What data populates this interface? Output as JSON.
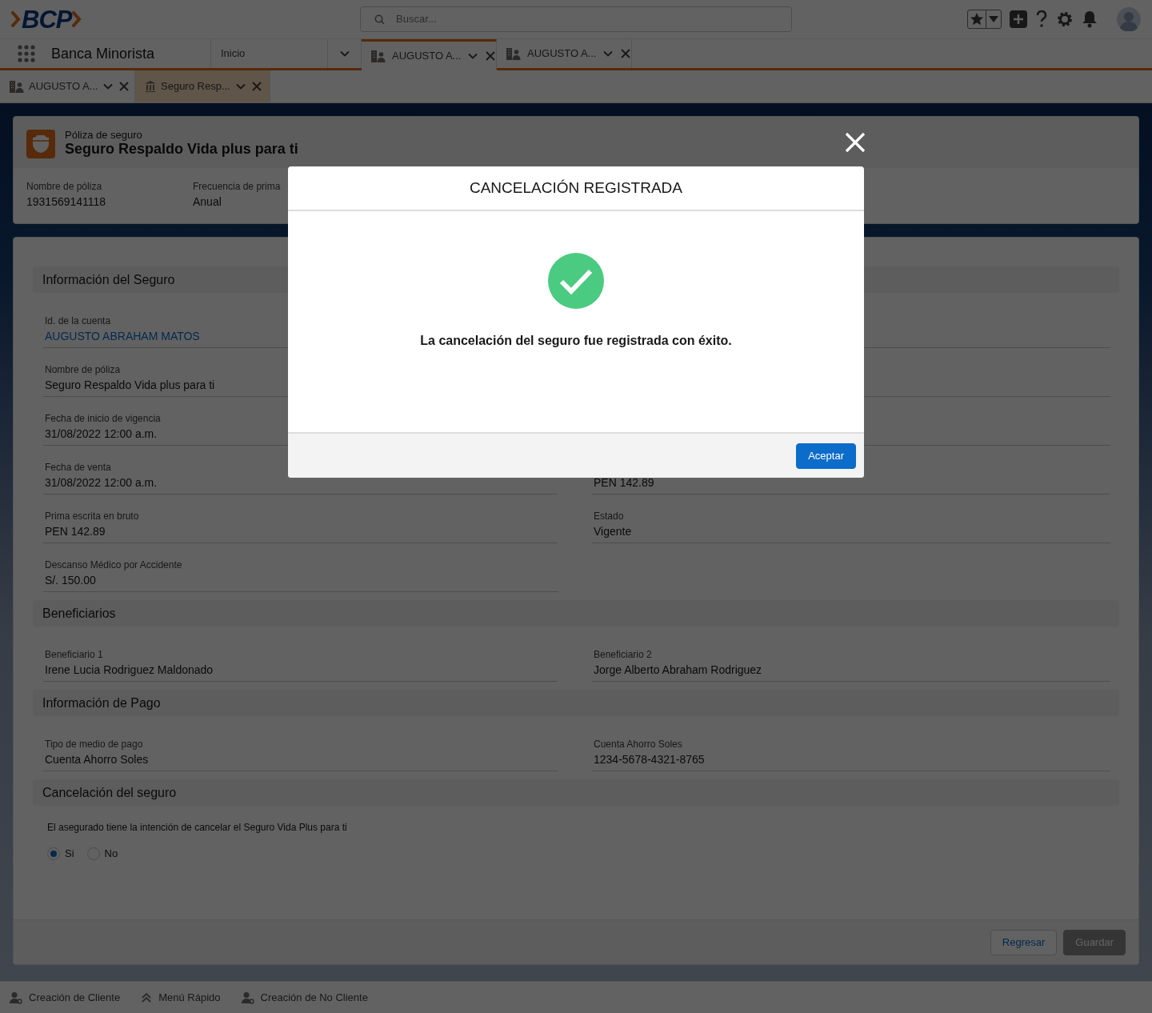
{
  "header": {
    "logo": "BCP",
    "search": {
      "placeholder": "Buscar..."
    }
  },
  "app": {
    "name": "Banca Minorista"
  },
  "nav_tabs": [
    {
      "label": "Inicio",
      "kind": "home",
      "selected": false
    },
    {
      "label": "AUGUSTO A...",
      "kind": "record",
      "selected": true
    },
    {
      "label": "AUGUSTO A...",
      "kind": "record",
      "selected": false
    }
  ],
  "subtabs": [
    {
      "label": "AUGUSTO A...",
      "kind": "person",
      "selected": false
    },
    {
      "label": "Seguro Resp...",
      "kind": "bank",
      "selected": true
    }
  ],
  "record": {
    "type": "Póliza de seguro",
    "title": "Seguro Respaldo Vida plus para ti",
    "highlights": [
      {
        "label": "Nombre de póliza",
        "value": "1931569141118"
      },
      {
        "label": "Frecuencia de prima",
        "value": "Anual"
      }
    ]
  },
  "sections": [
    {
      "title": "Información del Seguro",
      "kind": "fields",
      "fields": [
        {
          "label": "Id. de la cuenta",
          "value": "AUGUSTO ABRAHAM MATOS",
          "kind": "link"
        },
        {
          "kind": "hidden"
        },
        {
          "label": "Nombre de póliza",
          "value": "Seguro Respaldo Vida plus para ti",
          "kind": "text"
        },
        {
          "kind": "hidden"
        },
        {
          "label": "Fecha de inicio de vigencia",
          "value": "31/08/2022 12:00 a.m.",
          "kind": "text"
        },
        {
          "kind": "hidden"
        },
        {
          "label": "Fecha de venta",
          "value": "31/08/2022 12:00 a.m.",
          "kind": "text"
        },
        {
          "value": "PEN 142.89",
          "kind": "text"
        },
        {
          "label": "Prima escrita en bruto",
          "value": "PEN 142.89",
          "kind": "text"
        },
        {
          "label": "Estado",
          "value": "Vigente",
          "kind": "text"
        },
        {
          "label": "Descanso Médico por Accidente",
          "value": "S/. 150.00",
          "kind": "text"
        }
      ]
    },
    {
      "title": "Beneficiarios",
      "kind": "fields",
      "fields": [
        {
          "label": "Beneficiario 1",
          "value": "Irene Lucia Rodriguez Maldonado",
          "kind": "text"
        },
        {
          "label": "Beneficiario 2",
          "value": "Jorge Alberto Abraham Rodriguez",
          "kind": "text"
        }
      ]
    },
    {
      "title": "Información de Pago",
      "kind": "fields",
      "fields": [
        {
          "label": "Tipo de medio de pago",
          "value": "Cuenta Ahorro Soles",
          "kind": "text"
        },
        {
          "label": "Cuenta Ahorro Soles",
          "value": "1234-5678-4321-8765",
          "kind": "text"
        }
      ]
    },
    {
      "title": "Cancelación del seguro",
      "kind": "question",
      "question": "El asegurado tiene la intención de cancelar el Seguro Vida Plus para ti",
      "options": [
        {
          "label": "Si",
          "selected": true
        },
        {
          "label": "No",
          "selected": false
        }
      ]
    }
  ],
  "footer_buttons": [
    {
      "label": "Regresar",
      "kind": "neutral",
      "disabled": false
    },
    {
      "label": "Guardar",
      "kind": "brand",
      "disabled": true
    }
  ],
  "utility_bar": [
    {
      "label": "Creación de Cliente",
      "kind": "person"
    },
    {
      "label": "Menú Rápido",
      "kind": "menu"
    },
    {
      "label": "Creación de No Cliente",
      "kind": "person"
    }
  ],
  "modal": {
    "title": "CANCELACIÓN REGISTRADA",
    "message": "La cancelación del seguro fue registrada con éxito.",
    "button": "Aceptar"
  }
}
